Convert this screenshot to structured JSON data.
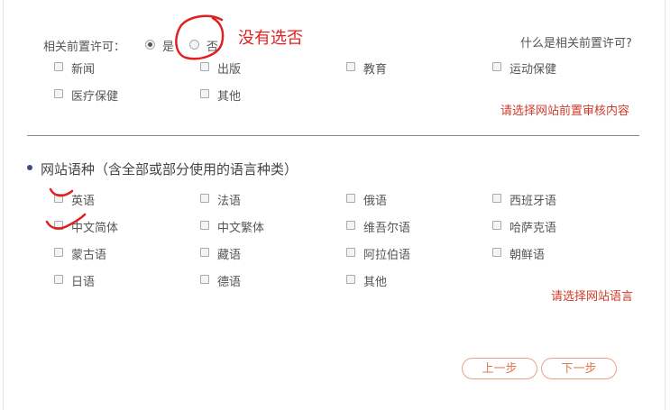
{
  "prereq": {
    "label": "相关前置许可：",
    "yes_label": "是",
    "no_label": "否",
    "help_link": "什么是相关前置许可?",
    "options": [
      "新闻",
      "出版",
      "教育",
      "运动保健",
      "医疗保健",
      "其他"
    ],
    "error": "请选择网站前置审核内容"
  },
  "languages": {
    "title": "网站语种（含全部或部分使用的语言种类）",
    "options": [
      "英语",
      "法语",
      "俄语",
      "西班牙语",
      "中文简体",
      "中文繁体",
      "维吾尔语",
      "哈萨克语",
      "蒙古语",
      "藏语",
      "阿拉伯语",
      "朝鲜语",
      "日语",
      "德语",
      "其他"
    ],
    "error": "请选择网站语言"
  },
  "buttons": {
    "prev": "上一步",
    "next": "下一步"
  },
  "annotation": {
    "note": "没有选否"
  },
  "colors": {
    "accent": "#e07a4f",
    "error": "#d03a2b",
    "annotation": "#e02020",
    "bullet": "#3b4a8a"
  }
}
